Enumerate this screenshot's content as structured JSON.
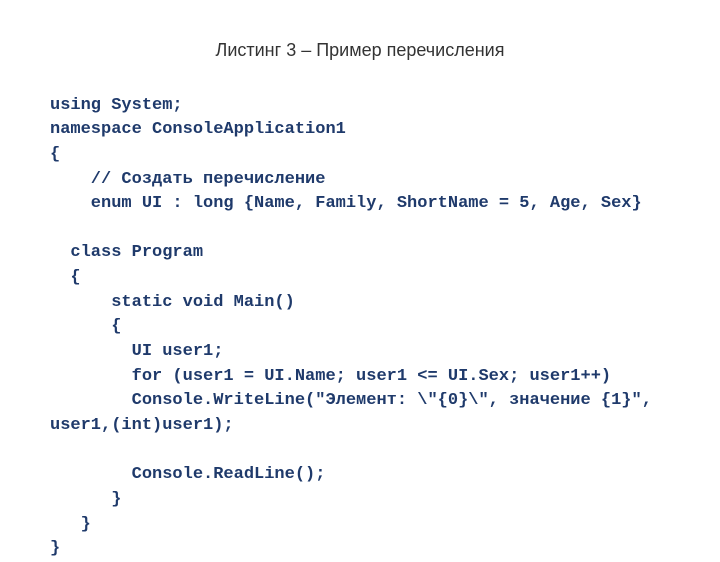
{
  "title": "Листинг 3 – Пример перечисления",
  "code": {
    "l01": "using System;",
    "l02": "namespace ConsoleApplication1",
    "l03": "{",
    "l04": "    // Создать перечисление",
    "l05": "    enum UI : long {Name, Family, ShortName = 5, Age, Sex}",
    "l06": "",
    "l07": "  class Program",
    "l08": "  {",
    "l09": "      static void Main()",
    "l10": "      {",
    "l11": "        UI user1;",
    "l12": "        for (user1 = UI.Name; user1 <= UI.Sex; user1++)",
    "l13": "        Console.WriteLine(\"Элемент: \\\"{0}\\\", значение {1}\",",
    "l14": "user1,(int)user1);",
    "l15": "",
    "l16": "        Console.ReadLine();",
    "l17": "      }",
    "l18": "   }",
    "l19": "}"
  }
}
